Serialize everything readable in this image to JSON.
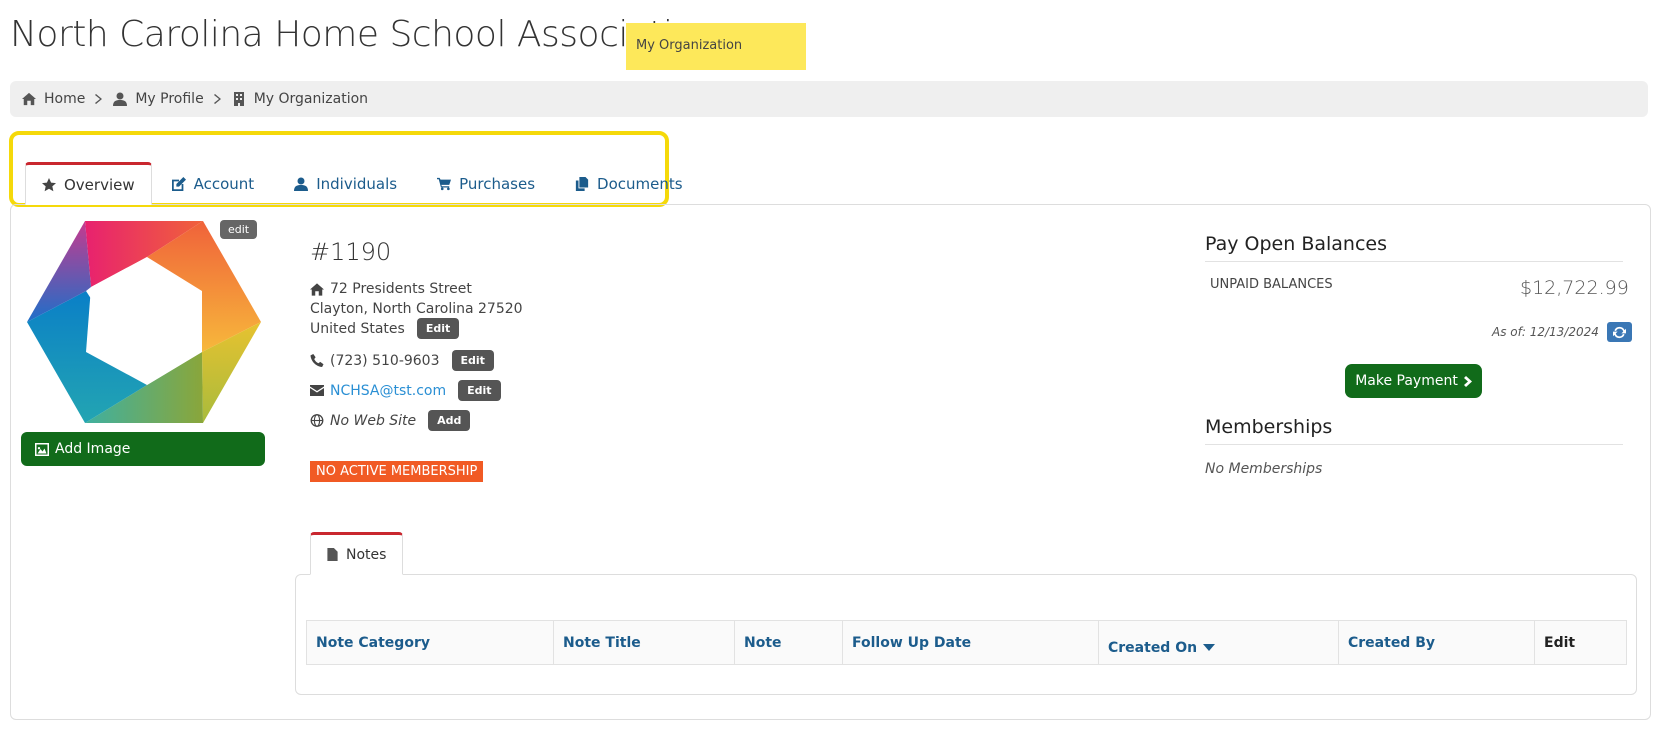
{
  "header": {
    "org_name": "North Carolina Home School Association",
    "highlight_label": "My Organization"
  },
  "breadcrumb": {
    "items": [
      {
        "label": "Home",
        "icon": "home-icon"
      },
      {
        "label": "My Profile",
        "icon": "user-icon"
      },
      {
        "label": "My Organization",
        "icon": "building-icon"
      }
    ]
  },
  "tabs": [
    {
      "label": "Overview",
      "icon": "star-icon",
      "active": true
    },
    {
      "label": "Account",
      "icon": "edit-icon"
    },
    {
      "label": "Individuals",
      "icon": "user-icon"
    },
    {
      "label": "Purchases",
      "icon": "cart-icon"
    },
    {
      "label": "Documents",
      "icon": "documents-icon"
    }
  ],
  "profile": {
    "edit_badge": "edit",
    "add_image_label": "Add Image",
    "account_number": "#1190",
    "address_line1": "72 Presidents Street",
    "address_line2": "Clayton, North Carolina 27520",
    "address_country": "United States",
    "address_edit_label": "Edit",
    "phone": "(723) 510-9603",
    "phone_edit_label": "Edit",
    "email": "NCHSA@tst.com",
    "email_edit_label": "Edit",
    "website": "No Web Site",
    "website_add_label": "Add",
    "membership_status": "NO ACTIVE MEMBERSHIP"
  },
  "balances": {
    "heading": "Pay Open Balances",
    "unpaid_label": "UNPAID BALANCES",
    "unpaid_value": "$12,722.99",
    "as_of": "As of: 12/13/2024",
    "pay_button_label": "Make Payment"
  },
  "memberships": {
    "heading": "Memberships",
    "empty_text": "No Memberships"
  },
  "notes": {
    "tab_label": "Notes",
    "columns": [
      "Note Category",
      "Note Title",
      "Note",
      "Follow Up Date",
      "Created On",
      "Created By",
      "Edit"
    ]
  },
  "colors": {
    "primary_green": "#116b1a",
    "link_blue": "#1c5c8c",
    "active_tab_red": "#c9272f",
    "highlight_yellow": "#fde85a",
    "warning_orange": "#f15a24"
  }
}
